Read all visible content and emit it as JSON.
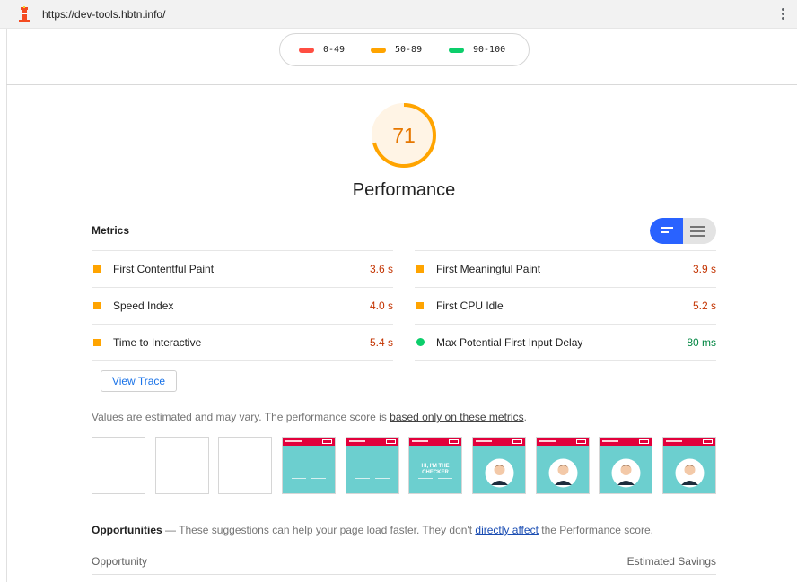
{
  "browser": {
    "url": "https://dev-tools.hbtn.info/",
    "logo_icon": "lighthouse-icon",
    "menu_icon": "kebab-menu-icon"
  },
  "legend": [
    {
      "label": "0-49",
      "color": "#ff4e42"
    },
    {
      "label": "50-89",
      "color": "#ffa400"
    },
    {
      "label": "90-100",
      "color": "#0cce6b"
    }
  ],
  "score": {
    "value": "71",
    "fraction": 0.71,
    "label": "Performance",
    "color": "#ffa400"
  },
  "metrics": {
    "title": "Metrics",
    "toggle": {
      "active_icon": "lines-short-icon",
      "inactive_icon": "lines-full-icon"
    },
    "left": [
      {
        "label": "First Contentful Paint",
        "value": "3.6 s",
        "status": "average"
      },
      {
        "label": "Speed Index",
        "value": "4.0 s",
        "status": "average"
      },
      {
        "label": "Time to Interactive",
        "value": "5.4 s",
        "status": "average"
      }
    ],
    "right": [
      {
        "label": "First Meaningful Paint",
        "value": "3.9 s",
        "status": "average"
      },
      {
        "label": "First CPU Idle",
        "value": "5.2 s",
        "status": "average"
      },
      {
        "label": "Max Potential First Input Delay",
        "value": "80 ms",
        "status": "pass"
      }
    ],
    "colors": {
      "average": "#ffa400",
      "average_text": "#c33300",
      "pass": "#0cce6b",
      "pass_text": "#018642"
    }
  },
  "view_trace": "View Trace",
  "note": {
    "prefix": "Values are estimated and may vary. The performance score is ",
    "link": "based only on these metrics",
    "suffix": "."
  },
  "filmstrip": {
    "frames": [
      "blank",
      "blank",
      "blank",
      "header-only",
      "header-only",
      "hello-text",
      "avatar",
      "avatar",
      "avatar",
      "avatar"
    ],
    "hello_text": "HI, I'M THE CHECKER"
  },
  "opportunities": {
    "title": "Opportunities",
    "dash": " — ",
    "desc_prefix": "These suggestions can help your page load faster. They don't ",
    "desc_link": "directly affect",
    "desc_suffix": " the Performance score.",
    "col_opportunity": "Opportunity",
    "col_savings": "Estimated Savings"
  }
}
